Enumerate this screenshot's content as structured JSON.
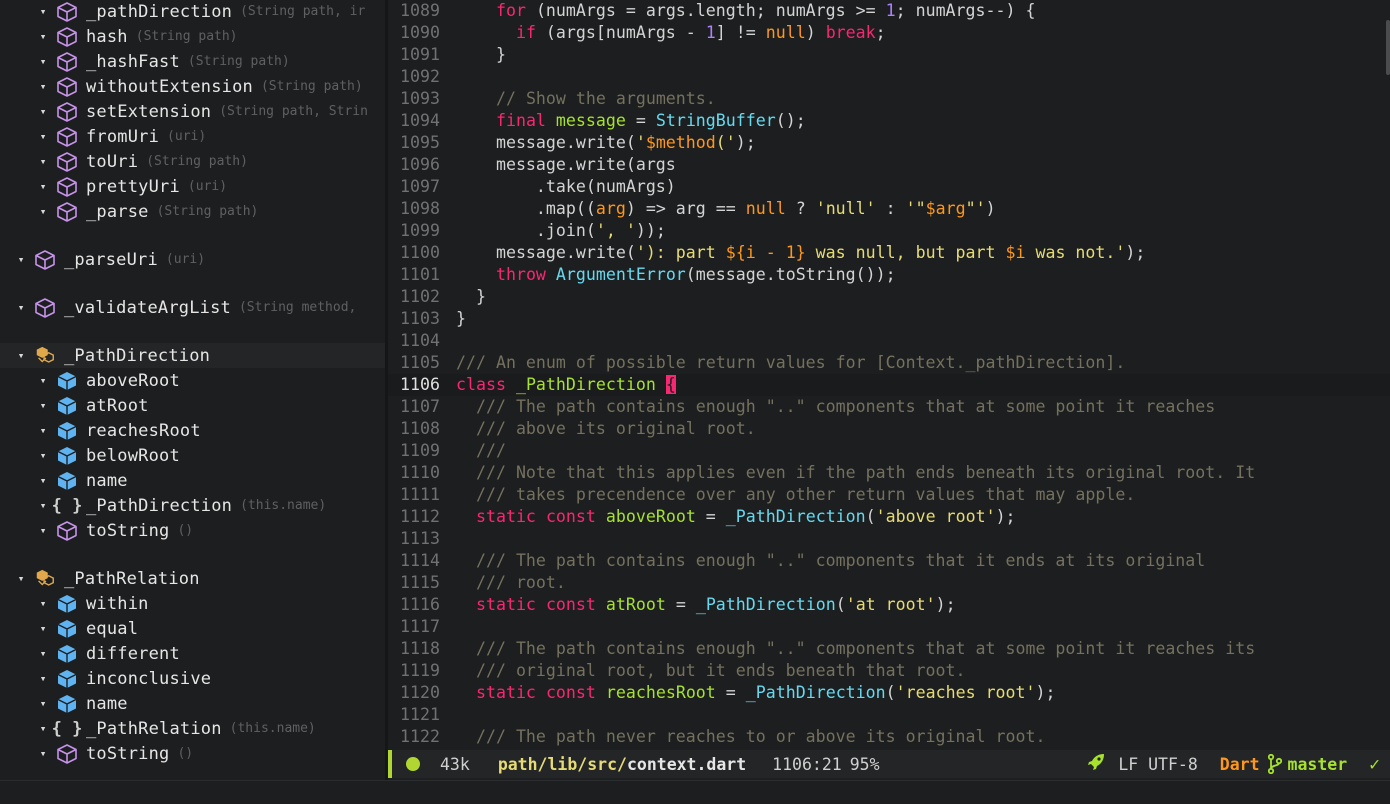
{
  "outline": [
    {
      "indent": 1,
      "kind": "method",
      "name": "_pathDirection",
      "params": "(String path, ir"
    },
    {
      "indent": 1,
      "kind": "method",
      "name": "hash",
      "params": "(String path)"
    },
    {
      "indent": 1,
      "kind": "method",
      "name": "_hashFast",
      "params": "(String path)"
    },
    {
      "indent": 1,
      "kind": "method",
      "name": "withoutExtension",
      "params": "(String path)"
    },
    {
      "indent": 1,
      "kind": "method",
      "name": "setExtension",
      "params": "(String path, Strin"
    },
    {
      "indent": 1,
      "kind": "method",
      "name": "fromUri",
      "params": "(uri)"
    },
    {
      "indent": 1,
      "kind": "method",
      "name": "toUri",
      "params": "(String path)"
    },
    {
      "indent": 1,
      "kind": "method",
      "name": "prettyUri",
      "params": "(uri)"
    },
    {
      "indent": 1,
      "kind": "method",
      "name": "_parse",
      "params": "(String path)"
    },
    {
      "gap": true
    },
    {
      "indent": 0,
      "kind": "method",
      "name": "_parseUri",
      "params": "(uri)"
    },
    {
      "gap": true
    },
    {
      "indent": 0,
      "kind": "method",
      "name": "_validateArgList",
      "params": "(String method, "
    },
    {
      "gap": true
    },
    {
      "indent": 0,
      "kind": "class",
      "name": "_PathDirection",
      "params": "",
      "highlight": true
    },
    {
      "indent": 1,
      "kind": "field",
      "name": "aboveRoot",
      "params": ""
    },
    {
      "indent": 1,
      "kind": "field",
      "name": "atRoot",
      "params": ""
    },
    {
      "indent": 1,
      "kind": "field",
      "name": "reachesRoot",
      "params": ""
    },
    {
      "indent": 1,
      "kind": "field",
      "name": "belowRoot",
      "params": ""
    },
    {
      "indent": 1,
      "kind": "field",
      "name": "name",
      "params": ""
    },
    {
      "indent": 1,
      "kind": "constructor",
      "name": "_PathDirection",
      "params": "(this.name)"
    },
    {
      "indent": 1,
      "kind": "method",
      "name": "toString",
      "params": "()"
    },
    {
      "gap": true
    },
    {
      "indent": 0,
      "kind": "class",
      "name": "_PathRelation",
      "params": ""
    },
    {
      "indent": 1,
      "kind": "field",
      "name": "within",
      "params": ""
    },
    {
      "indent": 1,
      "kind": "field",
      "name": "equal",
      "params": ""
    },
    {
      "indent": 1,
      "kind": "field",
      "name": "different",
      "params": ""
    },
    {
      "indent": 1,
      "kind": "field",
      "name": "inconclusive",
      "params": ""
    },
    {
      "indent": 1,
      "kind": "field",
      "name": "name",
      "params": ""
    },
    {
      "indent": 1,
      "kind": "constructor",
      "name": "_PathRelation",
      "params": "(this.name)"
    },
    {
      "indent": 1,
      "kind": "method",
      "name": "toString",
      "params": "()"
    }
  ],
  "colors": {
    "keyword": "#f92672",
    "type": "#66d9ef",
    "string": "#e6db74",
    "number": "#ae81ff",
    "comment": "#75715e",
    "definition": "#a6e22e",
    "constant": "#fd971f",
    "method_icon": "#c792ea",
    "field_icon": "#5fb3f0",
    "class_icon": "#e0a84a",
    "accent": "#b1d631"
  },
  "current_line": 1106,
  "code_lines": [
    {
      "n": "1089",
      "t": [
        [
          "    ",
          ""
        ],
        [
          "for",
          "kw"
        ],
        [
          " (numArgs = args.length; numArgs >= ",
          ""
        ],
        [
          "1",
          "num"
        ],
        [
          "; numArgs--) {",
          ""
        ]
      ]
    },
    {
      "n": "1090",
      "t": [
        [
          "      ",
          ""
        ],
        [
          "if",
          "kw"
        ],
        [
          " (args[numArgs - ",
          ""
        ],
        [
          "1",
          "num"
        ],
        [
          "] != ",
          ""
        ],
        [
          "null",
          "nul"
        ],
        [
          ") ",
          ""
        ],
        [
          "break",
          "kw"
        ],
        [
          ";",
          ""
        ]
      ]
    },
    {
      "n": "1091",
      "t": [
        [
          "    }",
          ""
        ]
      ]
    },
    {
      "n": "1092",
      "t": []
    },
    {
      "n": "1093",
      "t": [
        [
          "    ",
          ""
        ],
        [
          "// Show the arguments.",
          "cm"
        ]
      ]
    },
    {
      "n": "1094",
      "t": [
        [
          "    ",
          ""
        ],
        [
          "final",
          "kw"
        ],
        [
          " ",
          ""
        ],
        [
          "message",
          "df"
        ],
        [
          " = ",
          ""
        ],
        [
          "StringBuffer",
          "ty"
        ],
        [
          "();",
          ""
        ]
      ]
    },
    {
      "n": "1095",
      "t": [
        [
          "    message.write(",
          ""
        ],
        [
          "'",
          "str"
        ],
        [
          "$method",
          "itp"
        ],
        [
          "('",
          "str"
        ],
        [
          ");",
          ""
        ]
      ]
    },
    {
      "n": "1096",
      "t": [
        [
          "    message.write(args",
          ""
        ]
      ]
    },
    {
      "n": "1097",
      "t": [
        [
          "        .take(numArgs)",
          ""
        ]
      ]
    },
    {
      "n": "1098",
      "t": [
        [
          "        .map((",
          ""
        ],
        [
          "arg",
          "nul"
        ],
        [
          ") => arg == ",
          ""
        ],
        [
          "null",
          "nul"
        ],
        [
          " ? ",
          ""
        ],
        [
          "'null'",
          "str"
        ],
        [
          " : ",
          ""
        ],
        [
          "'\"",
          "str"
        ],
        [
          "$arg",
          "itp"
        ],
        [
          "\"'",
          "str"
        ],
        [
          ")",
          ""
        ]
      ]
    },
    {
      "n": "1099",
      "t": [
        [
          "        .join(",
          ""
        ],
        [
          "', '",
          "str"
        ],
        [
          "));",
          ""
        ]
      ]
    },
    {
      "n": "1100",
      "t": [
        [
          "    message.write(",
          ""
        ],
        [
          "'): part ",
          "str"
        ],
        [
          "${i - 1}",
          "itp"
        ],
        [
          " was null, but part ",
          "str"
        ],
        [
          "$i",
          "itp"
        ],
        [
          " was not.'",
          "str"
        ],
        [
          ");",
          ""
        ]
      ]
    },
    {
      "n": "1101",
      "t": [
        [
          "    ",
          ""
        ],
        [
          "throw",
          "kw"
        ],
        [
          " ",
          ""
        ],
        [
          "ArgumentError",
          "ty"
        ],
        [
          "(message.toString());",
          ""
        ]
      ]
    },
    {
      "n": "1102",
      "t": [
        [
          "  }",
          ""
        ]
      ]
    },
    {
      "n": "1103",
      "t": [
        [
          "}",
          ""
        ]
      ]
    },
    {
      "n": "1104",
      "t": []
    },
    {
      "n": "1105",
      "t": [
        [
          "/// An enum of possible return values for [Context._pathDirection].",
          "cm"
        ]
      ]
    },
    {
      "n": "1106",
      "t": [
        [
          "class",
          "kw"
        ],
        [
          " ",
          ""
        ],
        [
          "_PathDirection",
          "df"
        ],
        [
          " ",
          ""
        ],
        [
          "{",
          "curs"
        ]
      ]
    },
    {
      "n": "1107",
      "t": [
        [
          "  ",
          ""
        ],
        [
          "/// The path contains enough \"..\" components that at some point it reaches",
          "cm"
        ]
      ]
    },
    {
      "n": "1108",
      "t": [
        [
          "  ",
          ""
        ],
        [
          "/// above its original root.",
          "cm"
        ]
      ]
    },
    {
      "n": "1109",
      "t": [
        [
          "  ",
          ""
        ],
        [
          "///",
          "cm"
        ]
      ]
    },
    {
      "n": "1110",
      "t": [
        [
          "  ",
          ""
        ],
        [
          "/// Note that this applies even if the path ends beneath its original root. It",
          "cm"
        ]
      ]
    },
    {
      "n": "1111",
      "t": [
        [
          "  ",
          ""
        ],
        [
          "/// takes precendence over any other return values that may apple.",
          "cm"
        ]
      ]
    },
    {
      "n": "1112",
      "t": [
        [
          "  ",
          ""
        ],
        [
          "static",
          "kw"
        ],
        [
          " ",
          ""
        ],
        [
          "const",
          "kw"
        ],
        [
          " ",
          ""
        ],
        [
          "aboveRoot",
          "df"
        ],
        [
          " = ",
          ""
        ],
        [
          "_PathDirection",
          "ty"
        ],
        [
          "(",
          ""
        ],
        [
          "'above root'",
          "str"
        ],
        [
          ");",
          ""
        ]
      ]
    },
    {
      "n": "1113",
      "t": []
    },
    {
      "n": "1114",
      "t": [
        [
          "  ",
          ""
        ],
        [
          "/// The path contains enough \"..\" components that it ends at its original",
          "cm"
        ]
      ]
    },
    {
      "n": "1115",
      "t": [
        [
          "  ",
          ""
        ],
        [
          "/// root.",
          "cm"
        ]
      ]
    },
    {
      "n": "1116",
      "t": [
        [
          "  ",
          ""
        ],
        [
          "static",
          "kw"
        ],
        [
          " ",
          ""
        ],
        [
          "const",
          "kw"
        ],
        [
          " ",
          ""
        ],
        [
          "atRoot",
          "df"
        ],
        [
          " = ",
          ""
        ],
        [
          "_PathDirection",
          "ty"
        ],
        [
          "(",
          ""
        ],
        [
          "'at root'",
          "str"
        ],
        [
          ");",
          ""
        ]
      ]
    },
    {
      "n": "1117",
      "t": []
    },
    {
      "n": "1118",
      "t": [
        [
          "  ",
          ""
        ],
        [
          "/// The path contains enough \"..\" components that at some point it reaches its",
          "cm"
        ]
      ]
    },
    {
      "n": "1119",
      "t": [
        [
          "  ",
          ""
        ],
        [
          "/// original root, but it ends beneath that root.",
          "cm"
        ]
      ]
    },
    {
      "n": "1120",
      "t": [
        [
          "  ",
          ""
        ],
        [
          "static",
          "kw"
        ],
        [
          " ",
          ""
        ],
        [
          "const",
          "kw"
        ],
        [
          " ",
          ""
        ],
        [
          "reachesRoot",
          "df"
        ],
        [
          " = ",
          ""
        ],
        [
          "_PathDirection",
          "ty"
        ],
        [
          "(",
          ""
        ],
        [
          "'reaches root'",
          "str"
        ],
        [
          ");",
          ""
        ]
      ]
    },
    {
      "n": "1121",
      "t": []
    },
    {
      "n": "1122",
      "t": [
        [
          "  ",
          ""
        ],
        [
          "/// The path never reaches to or above its original root.",
          "cm"
        ]
      ]
    }
  ],
  "modeline": {
    "size": "43k",
    "path_dir": "path/lib/src/",
    "path_file": "context.dart",
    "position": "1106:21",
    "percent": "95%",
    "eol_encoding": "LF UTF-8",
    "major_mode": "Dart",
    "branch": "master",
    "rocket_icon": "rocket-icon",
    "branch_icon": "git-branch-icon",
    "check_icon": "check-icon"
  }
}
